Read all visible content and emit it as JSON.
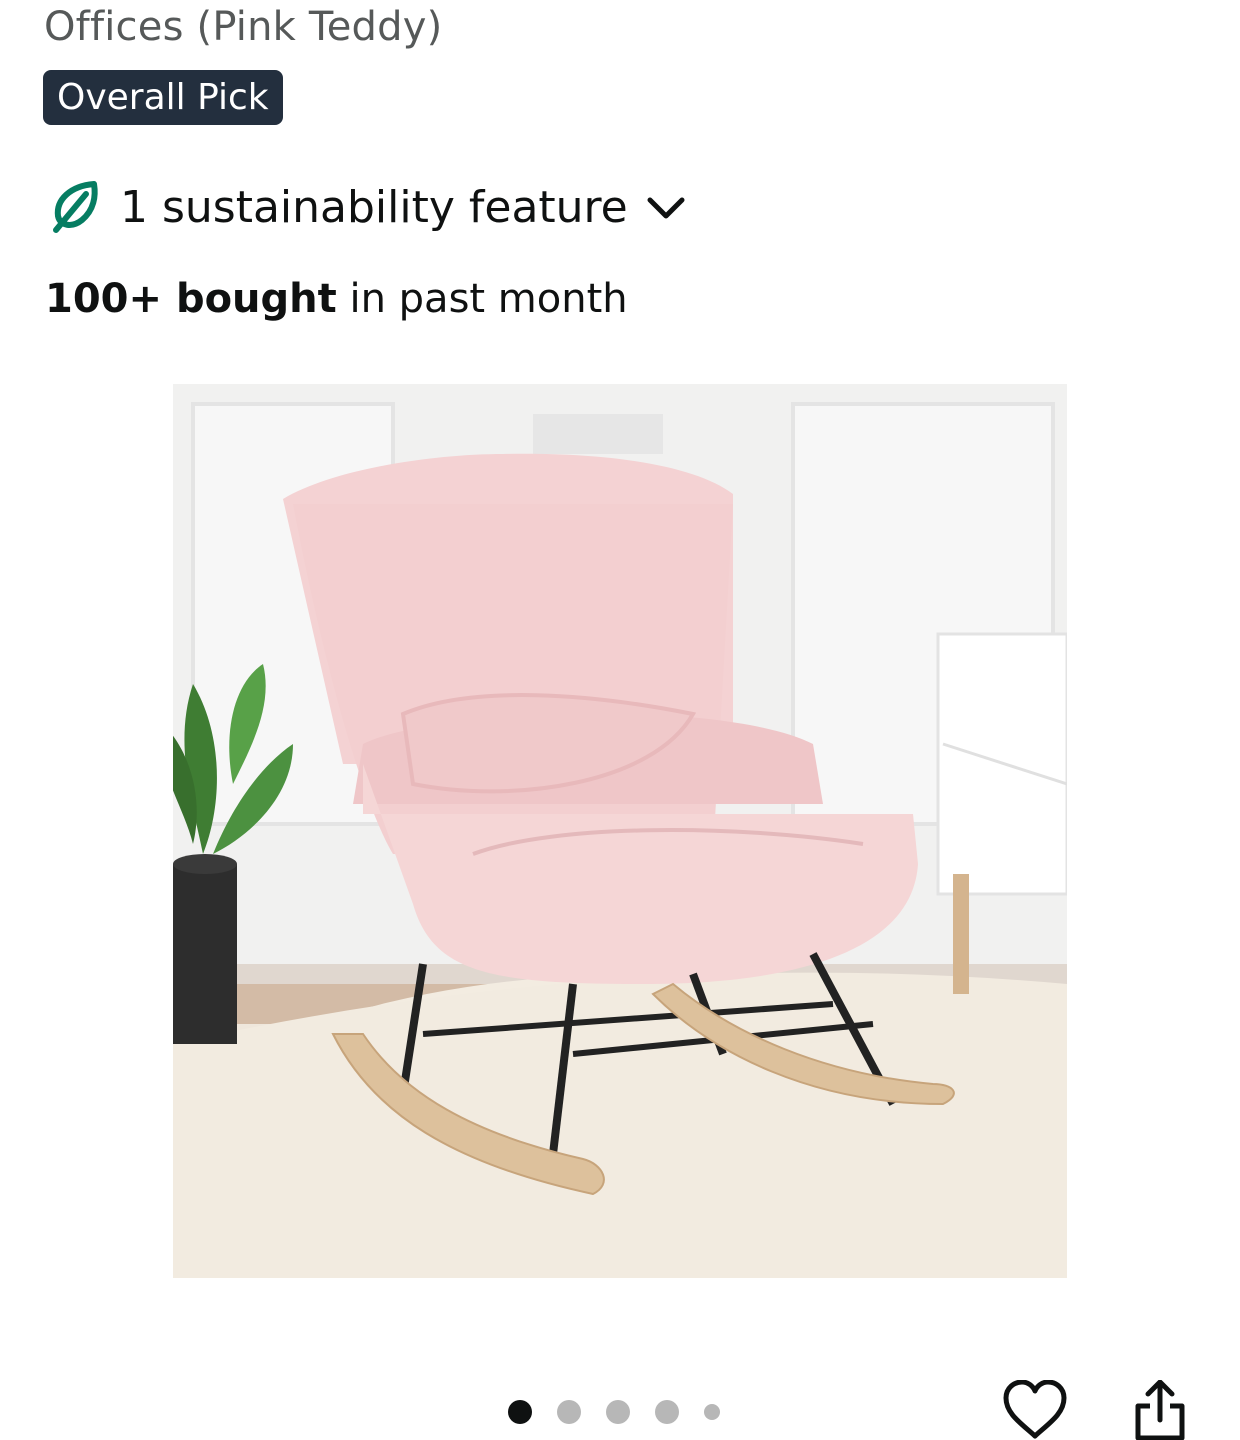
{
  "product": {
    "title_fragment": "Offices (Pink Teddy)",
    "badge": "Overall Pick",
    "sustainability": {
      "text": "1 sustainability feature",
      "icon": "leaf-icon",
      "toggle_icon": "chevron-down-icon"
    },
    "bought": {
      "bold": "100+ bought",
      "rest": " in past month"
    }
  },
  "gallery": {
    "image_subject": "pink teddy rocking chair",
    "total_images": 5,
    "current_index": 1
  },
  "actions": {
    "wishlist_icon": "heart-icon",
    "share_icon": "share-icon"
  },
  "colors": {
    "badge_bg": "#232f3e",
    "leaf_green": "#067d62",
    "text": "#0f1111",
    "muted_text": "#565959",
    "chair_pink": "#f3cfd0"
  }
}
